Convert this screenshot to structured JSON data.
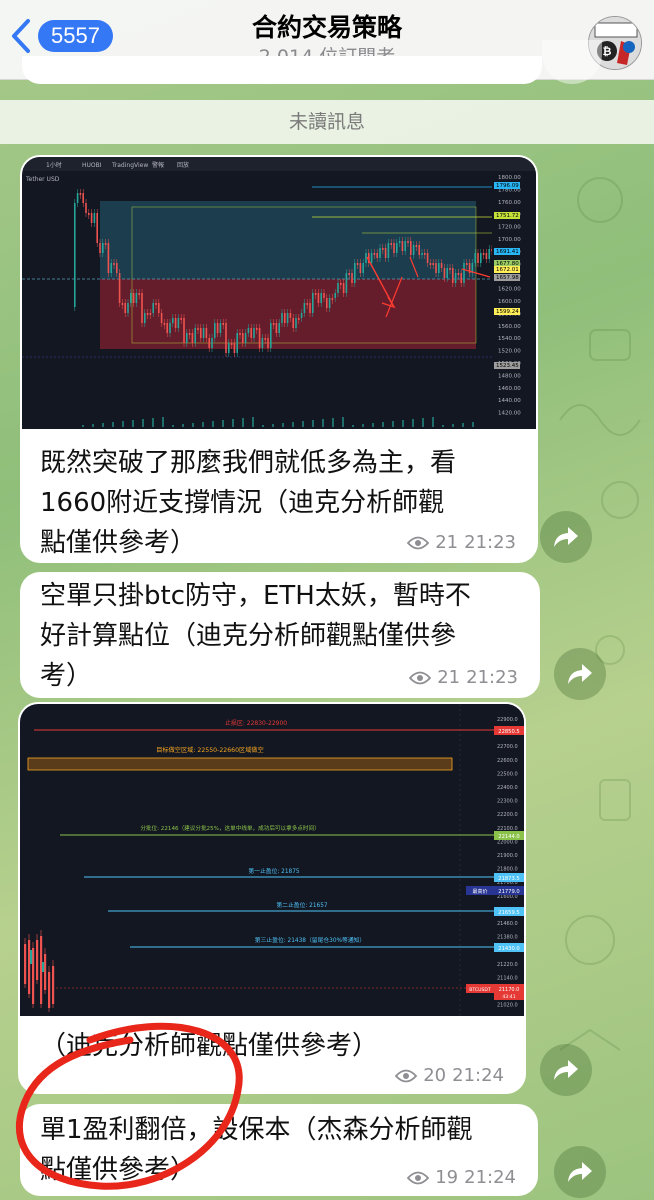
{
  "header": {
    "back_count": "5557",
    "title": "合約交易策略",
    "subscribers": "2,014 位訂閱者"
  },
  "unread_label": "未讀訊息",
  "messages": [
    {
      "type": "photo_text",
      "text": "既然突破了那麼我們就低多為主，看1660附近支撐情況（迪克分析師觀點僅供參考）",
      "lines": [
        "既然突破了那麼我們就低多為主，看",
        "1660附近支撐情況（迪克分析師觀",
        "點僅供參考）"
      ],
      "views": "21",
      "time": "21:23"
    },
    {
      "type": "text",
      "lines": [
        "空單只掛btc防守，ETH太妖，暫時不",
        "好計算點位（迪克分析師觀點僅供參",
        "考）"
      ],
      "views": "21",
      "time": "21:23"
    },
    {
      "type": "photo_text",
      "lines": [
        "（迪克分析師觀點僅供參考）"
      ],
      "views": "20",
      "time": "21:24"
    },
    {
      "type": "text",
      "lines": [
        "單1盈利翻倍，設保本（杰森分析師觀",
        "點僅供參考）"
      ],
      "views": "19",
      "time": "21:24"
    }
  ],
  "chart1": {
    "toolbar": [
      "1小时",
      "HUOBI",
      "TradingView",
      "警報",
      "回放"
    ],
    "pair": "Tether USD",
    "price_ticks": [
      "1800.00",
      "1780.00",
      "1760.00",
      "1740.00",
      "1720.00",
      "1700.00",
      "1680.00",
      "1660.00",
      "1640.00",
      "1620.00",
      "1600.00",
      "1580.00",
      "1560.00",
      "1540.00",
      "1520.00",
      "1500.00",
      "1480.00",
      "1460.00",
      "1440.00",
      "1420.00"
    ],
    "tag_labels": [
      "1796.09",
      "1751.72",
      "1691.41",
      "1677.80",
      "1672.01",
      "1657.98",
      "1599.24",
      "1523.45"
    ],
    "tag_colors": [
      "#29b6f6",
      "#c6e03a",
      "#29b6f6",
      "#9ccc65",
      "#ffee58",
      "#9e9e9e",
      "#ffee58",
      "#9e9e9e"
    ]
  },
  "chart2": {
    "price_ticks": [
      "22900.0",
      "22800.0",
      "22700.0",
      "22600.0",
      "22500.0",
      "22400.0",
      "22300.0",
      "22200.0",
      "22100.0",
      "22000.0",
      "21900.0",
      "21800.0",
      "21700.0",
      "21600.0",
      "21540.0",
      "21460.0",
      "21380.0",
      "21300.0",
      "21220.0",
      "21140.0",
      "21060.0",
      "21020.0"
    ],
    "stop_loss": "止损区: 22830-22900",
    "stop_tag": "22850.5",
    "target_zone": "目标做空区域: 22550-22660区域做空",
    "partial": "分批位: 22146（建议分批25%，这单中线单，成功后可以拿多点时间）",
    "partial_tag": "22144.0",
    "tp1": "第一止盈位: 21875",
    "tp1_tag": "21873.5",
    "current_label": "最高价",
    "current_tag": "21779.0",
    "tp2": "第二止盈位: 21657",
    "tp2_tag": "21659.5",
    "tp3": "第三止盈位: 21438（留尾仓30%等通知）",
    "tp3_tag": "21430.0",
    "last_tag_name": "BTCUSDT",
    "last_tag": "21170.0",
    "last_tag_sub": "43:41",
    "colors": {
      "stop": "#e53935",
      "target": "#f6a623",
      "partial": "#8bc34a",
      "tp": "#4fc3f7",
      "current": "#283593"
    }
  }
}
